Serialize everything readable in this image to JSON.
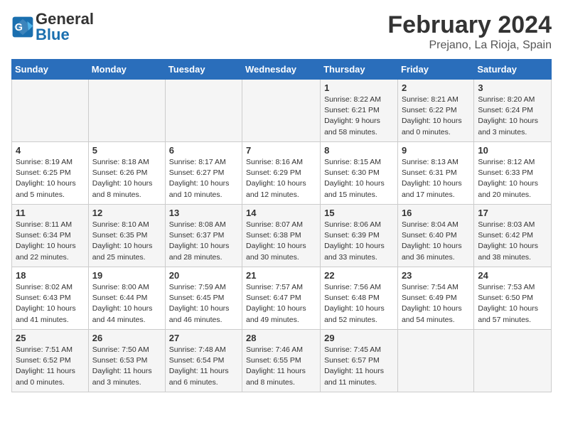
{
  "header": {
    "logo_text_general": "General",
    "logo_text_blue": "Blue",
    "title": "February 2024",
    "subtitle": "Prejano, La Rioja, Spain"
  },
  "weekdays": [
    "Sunday",
    "Monday",
    "Tuesday",
    "Wednesday",
    "Thursday",
    "Friday",
    "Saturday"
  ],
  "weeks": [
    [
      {
        "num": "",
        "info": ""
      },
      {
        "num": "",
        "info": ""
      },
      {
        "num": "",
        "info": ""
      },
      {
        "num": "",
        "info": ""
      },
      {
        "num": "1",
        "info": "Sunrise: 8:22 AM\nSunset: 6:21 PM\nDaylight: 9 hours and 58 minutes."
      },
      {
        "num": "2",
        "info": "Sunrise: 8:21 AM\nSunset: 6:22 PM\nDaylight: 10 hours and 0 minutes."
      },
      {
        "num": "3",
        "info": "Sunrise: 8:20 AM\nSunset: 6:24 PM\nDaylight: 10 hours and 3 minutes."
      }
    ],
    [
      {
        "num": "4",
        "info": "Sunrise: 8:19 AM\nSunset: 6:25 PM\nDaylight: 10 hours and 5 minutes."
      },
      {
        "num": "5",
        "info": "Sunrise: 8:18 AM\nSunset: 6:26 PM\nDaylight: 10 hours and 8 minutes."
      },
      {
        "num": "6",
        "info": "Sunrise: 8:17 AM\nSunset: 6:27 PM\nDaylight: 10 hours and 10 minutes."
      },
      {
        "num": "7",
        "info": "Sunrise: 8:16 AM\nSunset: 6:29 PM\nDaylight: 10 hours and 12 minutes."
      },
      {
        "num": "8",
        "info": "Sunrise: 8:15 AM\nSunset: 6:30 PM\nDaylight: 10 hours and 15 minutes."
      },
      {
        "num": "9",
        "info": "Sunrise: 8:13 AM\nSunset: 6:31 PM\nDaylight: 10 hours and 17 minutes."
      },
      {
        "num": "10",
        "info": "Sunrise: 8:12 AM\nSunset: 6:33 PM\nDaylight: 10 hours and 20 minutes."
      }
    ],
    [
      {
        "num": "11",
        "info": "Sunrise: 8:11 AM\nSunset: 6:34 PM\nDaylight: 10 hours and 22 minutes."
      },
      {
        "num": "12",
        "info": "Sunrise: 8:10 AM\nSunset: 6:35 PM\nDaylight: 10 hours and 25 minutes."
      },
      {
        "num": "13",
        "info": "Sunrise: 8:08 AM\nSunset: 6:37 PM\nDaylight: 10 hours and 28 minutes."
      },
      {
        "num": "14",
        "info": "Sunrise: 8:07 AM\nSunset: 6:38 PM\nDaylight: 10 hours and 30 minutes."
      },
      {
        "num": "15",
        "info": "Sunrise: 8:06 AM\nSunset: 6:39 PM\nDaylight: 10 hours and 33 minutes."
      },
      {
        "num": "16",
        "info": "Sunrise: 8:04 AM\nSunset: 6:40 PM\nDaylight: 10 hours and 36 minutes."
      },
      {
        "num": "17",
        "info": "Sunrise: 8:03 AM\nSunset: 6:42 PM\nDaylight: 10 hours and 38 minutes."
      }
    ],
    [
      {
        "num": "18",
        "info": "Sunrise: 8:02 AM\nSunset: 6:43 PM\nDaylight: 10 hours and 41 minutes."
      },
      {
        "num": "19",
        "info": "Sunrise: 8:00 AM\nSunset: 6:44 PM\nDaylight: 10 hours and 44 minutes."
      },
      {
        "num": "20",
        "info": "Sunrise: 7:59 AM\nSunset: 6:45 PM\nDaylight: 10 hours and 46 minutes."
      },
      {
        "num": "21",
        "info": "Sunrise: 7:57 AM\nSunset: 6:47 PM\nDaylight: 10 hours and 49 minutes."
      },
      {
        "num": "22",
        "info": "Sunrise: 7:56 AM\nSunset: 6:48 PM\nDaylight: 10 hours and 52 minutes."
      },
      {
        "num": "23",
        "info": "Sunrise: 7:54 AM\nSunset: 6:49 PM\nDaylight: 10 hours and 54 minutes."
      },
      {
        "num": "24",
        "info": "Sunrise: 7:53 AM\nSunset: 6:50 PM\nDaylight: 10 hours and 57 minutes."
      }
    ],
    [
      {
        "num": "25",
        "info": "Sunrise: 7:51 AM\nSunset: 6:52 PM\nDaylight: 11 hours and 0 minutes."
      },
      {
        "num": "26",
        "info": "Sunrise: 7:50 AM\nSunset: 6:53 PM\nDaylight: 11 hours and 3 minutes."
      },
      {
        "num": "27",
        "info": "Sunrise: 7:48 AM\nSunset: 6:54 PM\nDaylight: 11 hours and 6 minutes."
      },
      {
        "num": "28",
        "info": "Sunrise: 7:46 AM\nSunset: 6:55 PM\nDaylight: 11 hours and 8 minutes."
      },
      {
        "num": "29",
        "info": "Sunrise: 7:45 AM\nSunset: 6:57 PM\nDaylight: 11 hours and 11 minutes."
      },
      {
        "num": "",
        "info": ""
      },
      {
        "num": "",
        "info": ""
      }
    ]
  ]
}
